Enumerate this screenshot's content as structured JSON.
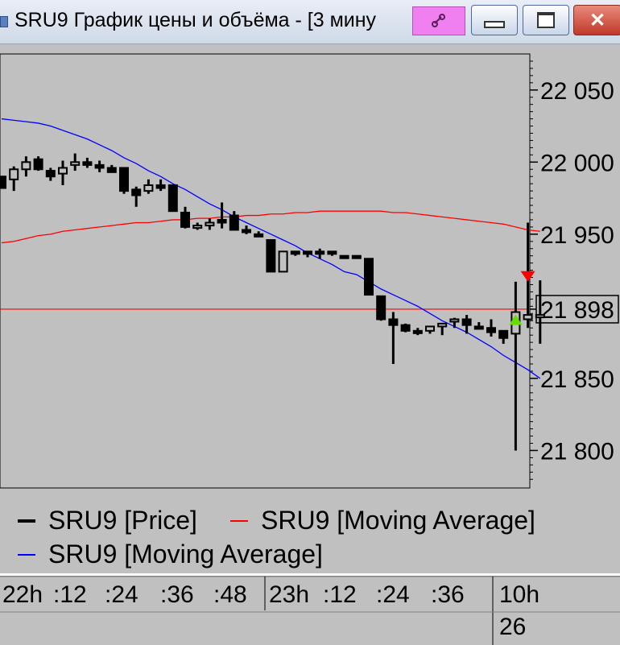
{
  "window": {
    "title": "SRU9 График цены и объёма - [3 мину",
    "pin_icon": "link-icon",
    "buttons": {
      "minimize": "minimize-icon",
      "maximize": "maximize-icon",
      "close": "close-icon"
    }
  },
  "chart_data": {
    "type": "line",
    "series": [
      {
        "name": "SRU9 [Price]",
        "kind": "candlestick",
        "color": "#000000",
        "candles": [
          [
            21990,
            21990,
            21982,
            21982
          ],
          [
            21988,
            21997,
            21980,
            21995
          ],
          [
            21995,
            22004,
            21990,
            22000
          ],
          [
            22002,
            22004,
            21994,
            21995
          ],
          [
            21994,
            21996,
            21987,
            21990
          ],
          [
            21992,
            22001,
            21984,
            21996
          ],
          [
            21998,
            22006,
            21994,
            22000
          ],
          [
            22000,
            22003,
            21996,
            21998
          ],
          [
            21998,
            22001,
            21993,
            21996
          ],
          [
            21996,
            21998,
            21993,
            21993
          ],
          [
            21996,
            21996,
            21978,
            21980
          ],
          [
            21981,
            21983,
            21969,
            21977
          ],
          [
            21980,
            21988,
            21978,
            21984
          ],
          [
            21984,
            21988,
            21980,
            21982
          ],
          [
            21984,
            21984,
            21969,
            21966
          ],
          [
            21965,
            21969,
            21954,
            21955
          ],
          [
            21955,
            21958,
            21953,
            21956
          ],
          [
            21956,
            21961,
            21953,
            21958
          ],
          [
            21960,
            21972,
            21954,
            21958
          ],
          [
            21963,
            21966,
            21953,
            21953
          ],
          [
            21953,
            21956,
            21950,
            21952
          ],
          [
            21950,
            21952,
            21948,
            21950
          ],
          [
            21946,
            21946,
            21929,
            21924
          ],
          [
            21924,
            21938,
            21924,
            21938
          ],
          [
            21938,
            21938,
            21935,
            21938
          ],
          [
            21938,
            21938,
            21934,
            21938
          ],
          [
            21938,
            21940,
            21933,
            21938
          ],
          [
            21938,
            21938,
            21935,
            21938
          ],
          [
            21935,
            21935,
            21935,
            21935
          ],
          [
            21935,
            21935,
            21935,
            21935
          ],
          [
            21933,
            21933,
            21919,
            21908
          ],
          [
            21907,
            21907,
            21890,
            21891
          ],
          [
            21891,
            21896,
            21860,
            21887
          ],
          [
            21887,
            21888,
            21882,
            21883
          ],
          [
            21883,
            21885,
            21880,
            21883
          ],
          [
            21883,
            21886,
            21881,
            21886
          ],
          [
            21886,
            21888,
            21880,
            21888
          ],
          [
            21890,
            21892,
            21885,
            21891
          ],
          [
            21891,
            21894,
            21881,
            21887
          ],
          [
            21886,
            21889,
            21884,
            21885
          ],
          [
            21885,
            21891,
            21879,
            21882
          ],
          [
            21883,
            21883,
            21874,
            21878
          ],
          [
            21881,
            21917,
            21800,
            21896
          ],
          [
            21891,
            21958,
            21885,
            21894
          ],
          [
            21893,
            21918,
            21874,
            21894
          ]
        ]
      },
      {
        "name": "SRU9 [Moving Average]",
        "color": "#ff0000",
        "values": [
          21944,
          21945,
          21947,
          21949,
          21950,
          21952,
          21953,
          21954,
          21955,
          21956,
          21957,
          21958,
          21958,
          21959,
          21960,
          21960,
          21961,
          21961,
          21962,
          21962,
          21963,
          21963,
          21964,
          21964,
          21965,
          21965,
          21966,
          21966,
          21966,
          21966,
          21966,
          21966,
          21965,
          21965,
          21964,
          21963,
          21962,
          21961,
          21960,
          21959,
          21958,
          21957,
          21955,
          21953,
          21952
        ]
      },
      {
        "name": "SRU9 [Moving Average]",
        "color": "#0000ff",
        "values": [
          22030,
          22029,
          22028,
          22027,
          22025,
          22022,
          22019,
          22016,
          22012,
          22008,
          22003,
          21999,
          21994,
          21990,
          21985,
          21981,
          21976,
          21971,
          21967,
          21962,
          21958,
          21954,
          21950,
          21946,
          21942,
          21937,
          21933,
          21929,
          21924,
          21922,
          21917,
          21912,
          21908,
          21904,
          21900,
          21895,
          21890,
          21886,
          21882,
          21877,
          21872,
          21866,
          21861,
          21856,
          21850
        ]
      }
    ],
    "reference_line": {
      "value": 21898,
      "color": "#ff0000"
    },
    "markers": [
      {
        "index": 42,
        "type": "buy",
        "color": "#66dd00",
        "value": 21891
      },
      {
        "index": 43,
        "type": "sell",
        "color": "#ff0000",
        "value": 21921
      }
    ],
    "y_ticks": [
      "22 050",
      "22 000",
      "21 950",
      "21 898",
      "21 850",
      "21 800"
    ],
    "y_tick_values": [
      22050,
      22000,
      21950,
      21898,
      21850,
      21800
    ],
    "current_value_label": "21 898",
    "ylim": [
      21774,
      22075
    ],
    "grid": false
  },
  "legend": {
    "items": [
      {
        "label": "SRU9 [Price]",
        "color": "#000000"
      },
      {
        "label": "SRU9 [Moving Average]",
        "color": "#ff0000"
      },
      {
        "label": "SRU9 [Moving Average]",
        "color": "#0000ff"
      }
    ]
  },
  "time_axis": {
    "labels": [
      "22h",
      ":12",
      ":24",
      ":36",
      ":48",
      "23h",
      ":12",
      ":24",
      ":36",
      "10h",
      "26"
    ]
  }
}
